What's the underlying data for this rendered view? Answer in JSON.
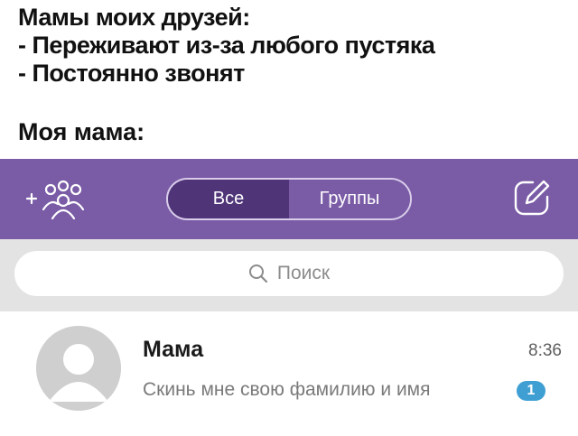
{
  "caption": {
    "lines": [
      "Мамы моих друзей:",
      "- Переживают из-за любого пустяка",
      "- Постоянно звонят"
    ],
    "my_mom": "Моя мама:"
  },
  "topbar": {
    "tabs": [
      {
        "label": "Все",
        "active": true
      },
      {
        "label": "Группы",
        "active": false
      }
    ],
    "add_icon": "add-contacts-icon",
    "compose_icon": "compose-icon",
    "color": "#7a5ba6"
  },
  "search": {
    "placeholder": "Поиск"
  },
  "chats": [
    {
      "name": "Мама",
      "time": "8:36",
      "preview": "Скинь мне свою фамилию и имя",
      "unread": "1"
    }
  ]
}
